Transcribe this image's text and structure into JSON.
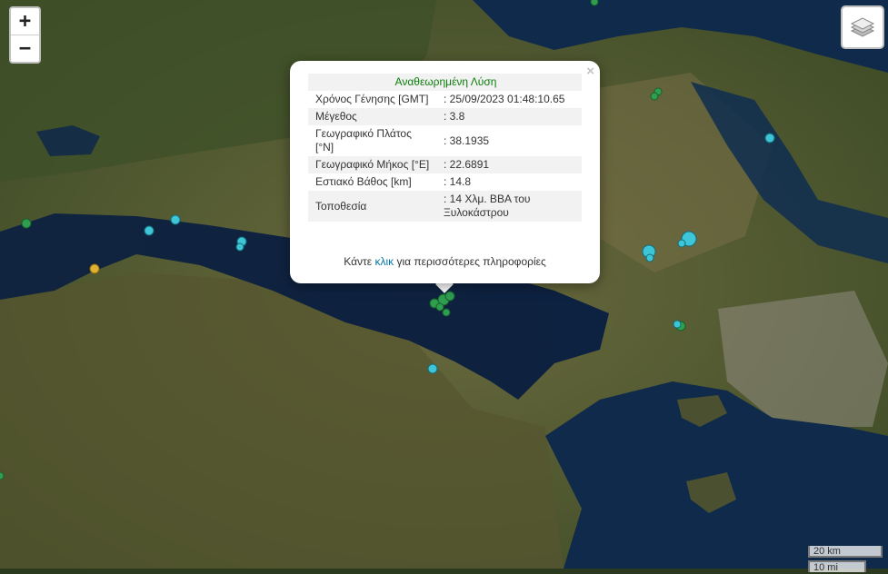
{
  "controls": {
    "zoom_in": "+",
    "zoom_out": "−"
  },
  "popup": {
    "title": "Αναθεωρημένη Λύση",
    "close": "×",
    "rows": [
      {
        "label": "Χρόνος Γένησης [GMT]",
        "value": ": 25/09/2023 01:48:10.65"
      },
      {
        "label": "Μέγεθος",
        "value": ": 3.8"
      },
      {
        "label": "Γεωγραφικό Πλάτος [°N]",
        "value": ": 38.1935"
      },
      {
        "label": "Γεωγραφικό Μήκος [°E]",
        "value": ": 22.6891"
      },
      {
        "label": "Εστιακό Βάθος [km]",
        "value": ": 14.8"
      },
      {
        "label": "Τοποθεσία",
        "value": ": 14 Χλμ. ΒΒΑ του Ξυλοκάστρου"
      }
    ],
    "more_before": "Κάντε ",
    "more_link": "κλικ",
    "more_after": " για περισσότερες πληροφορίες"
  },
  "scale": {
    "metric": "20 km",
    "imperial": "10 mi"
  },
  "colors": {
    "quake_green": "#2e9e4f",
    "quake_cyan": "#3ec6d8",
    "quake_yellow": "#e0b030"
  }
}
